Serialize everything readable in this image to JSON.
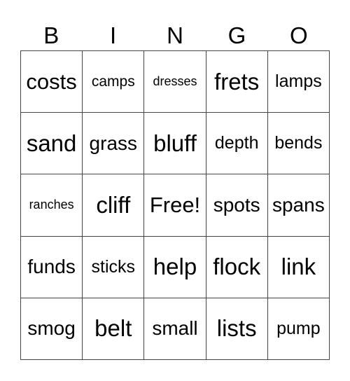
{
  "header": {
    "letters": [
      "B",
      "I",
      "N",
      "G",
      "O"
    ]
  },
  "card": {
    "rows": [
      [
        "costs",
        "camps",
        "dresses",
        "frets",
        "lamps"
      ],
      [
        "sand",
        "grass",
        "bluff",
        "depth",
        "bends"
      ],
      [
        "ranches",
        "cliff",
        "Free!",
        "spots",
        "spans"
      ],
      [
        "funds",
        "sticks",
        "help",
        "flock",
        "link"
      ],
      [
        "smog",
        "belt",
        "small",
        "lists",
        "pump"
      ]
    ],
    "free_space": "Free!"
  }
}
